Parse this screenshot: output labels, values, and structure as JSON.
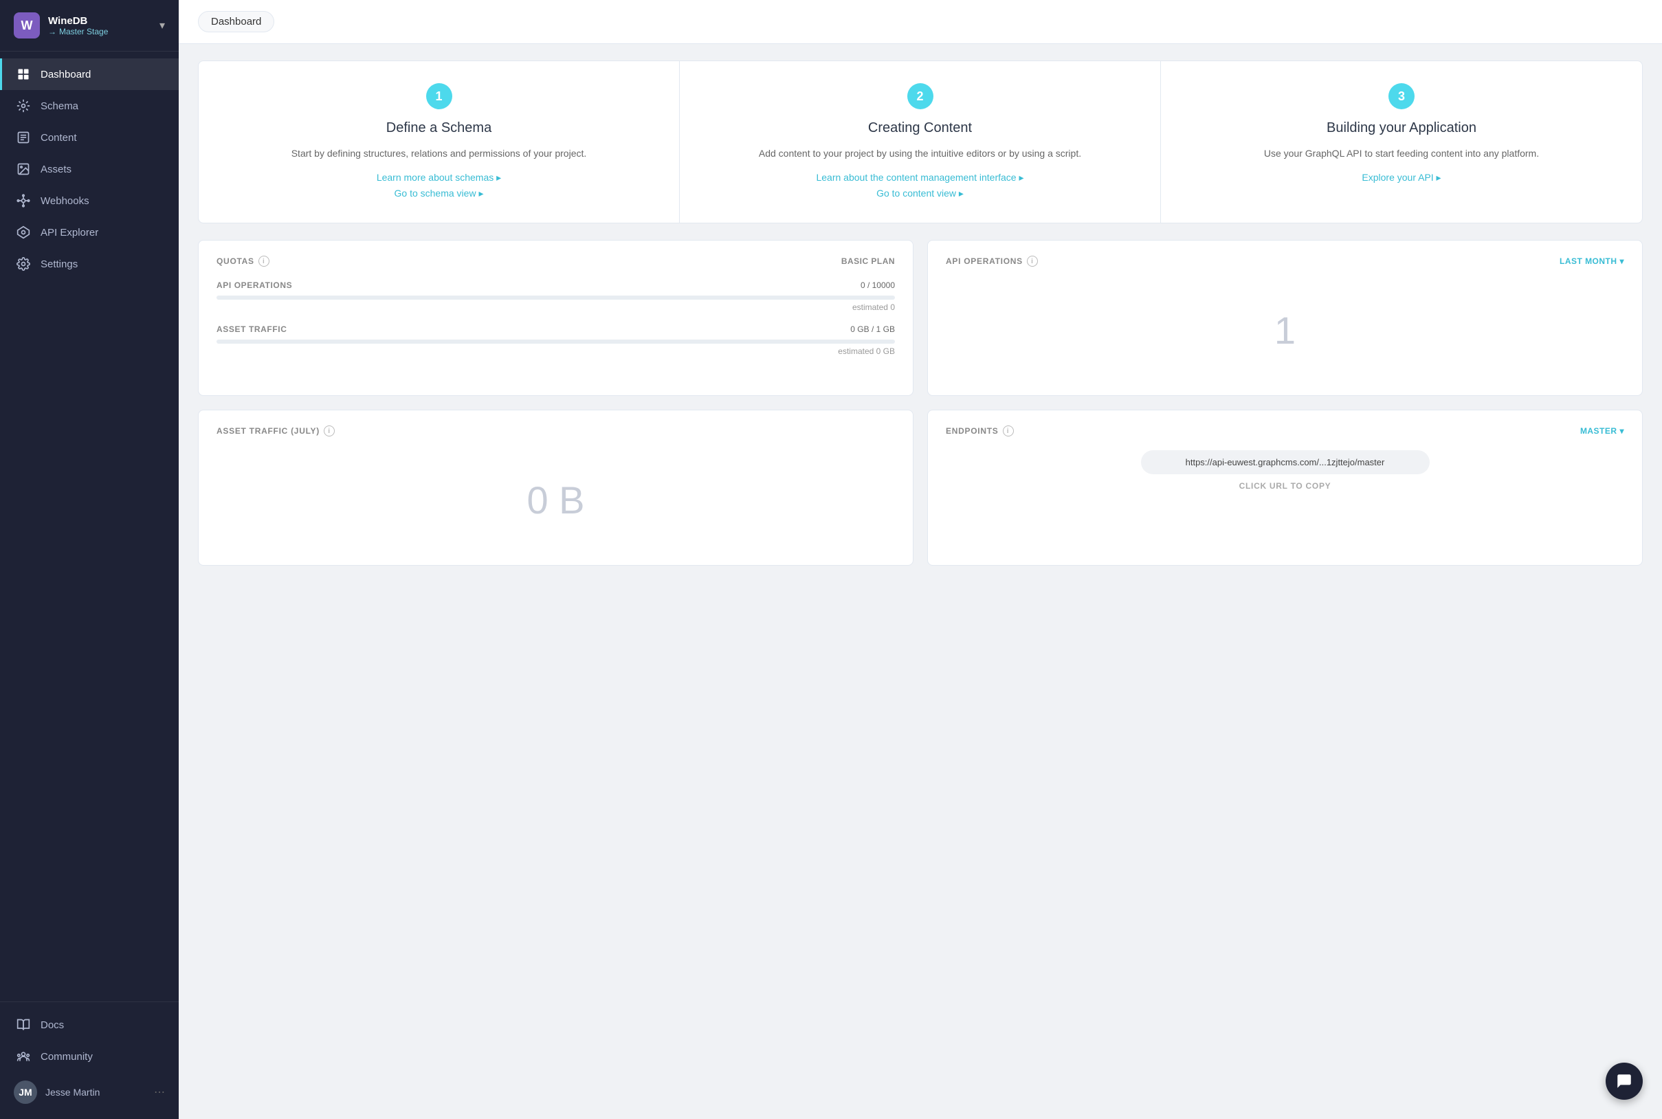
{
  "app": {
    "logo": "W",
    "name": "WineDB",
    "stage": "Master Stage",
    "dropdown_label": "▾"
  },
  "sidebar": {
    "nav_items": [
      {
        "id": "dashboard",
        "label": "Dashboard",
        "active": true
      },
      {
        "id": "schema",
        "label": "Schema",
        "active": false
      },
      {
        "id": "content",
        "label": "Content",
        "active": false
      },
      {
        "id": "assets",
        "label": "Assets",
        "active": false
      },
      {
        "id": "webhooks",
        "label": "Webhooks",
        "active": false
      },
      {
        "id": "api-explorer",
        "label": "API Explorer",
        "active": false
      },
      {
        "id": "settings",
        "label": "Settings",
        "active": false
      }
    ],
    "bottom_items": [
      {
        "id": "docs",
        "label": "Docs"
      },
      {
        "id": "community",
        "label": "Community"
      }
    ],
    "user": {
      "name": "Jesse Martin",
      "initials": "JM"
    }
  },
  "topbar": {
    "title": "Dashboard"
  },
  "steps": [
    {
      "number": "1",
      "title": "Define a Schema",
      "description": "Start by defining structures, relations and permissions of your project.",
      "links": [
        {
          "label": "Learn more about schemas ▸",
          "id": "learn-schemas"
        },
        {
          "label": "Go to schema view ▸",
          "id": "go-schema"
        }
      ]
    },
    {
      "number": "2",
      "title": "Creating Content",
      "description": "Add content to your project by using the intuitive editors or by using a script.",
      "links": [
        {
          "label": "Learn about the content management interface ▸",
          "id": "learn-content"
        },
        {
          "label": "Go to content view ▸",
          "id": "go-content"
        }
      ]
    },
    {
      "number": "3",
      "title": "Building your Application",
      "description": "Use your GraphQL API to start feeding content into any platform.",
      "links": [
        {
          "label": "Explore your API ▸",
          "id": "explore-api"
        }
      ]
    }
  ],
  "quotas_card": {
    "label": "QUOTAS",
    "badge": "BASIC PLAN",
    "rows": [
      {
        "name": "API OPERATIONS",
        "value": "0 / 10000",
        "fill_percent": 0,
        "estimated": "estimated 0"
      },
      {
        "name": "ASSET TRAFFIC",
        "value": "0 GB / 1 GB",
        "fill_percent": 0,
        "estimated": "estimated 0 GB"
      }
    ]
  },
  "api_operations_card": {
    "label": "API OPERATIONS",
    "action": "LAST MONTH",
    "value": "1"
  },
  "asset_traffic_card": {
    "label": "ASSET TRAFFIC (JULY)",
    "action": null,
    "value": "0 B"
  },
  "endpoints_card": {
    "label": "ENDPOINTS",
    "action": "MASTER",
    "url": "https://api-euwest.graphcms.com/...1zjttejo/master",
    "hint": "CLICK URL TO COPY"
  }
}
